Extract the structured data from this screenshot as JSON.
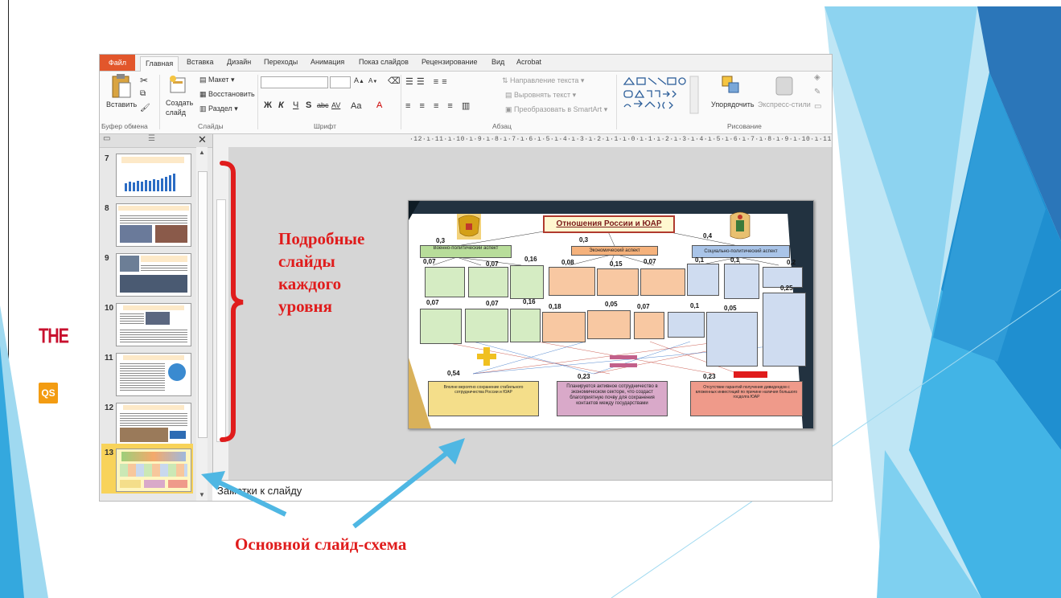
{
  "window": {
    "tabs": [
      "Файл",
      "Главная",
      "Вставка",
      "Дизайн",
      "Переходы",
      "Анимация",
      "Показ слайдов",
      "Рецензирование",
      "Вид",
      "Acrobat"
    ]
  },
  "ribbon": {
    "paste": "Вставить",
    "create_slide": "Создать",
    "create_slide_2": "слайд",
    "layout": "Макет",
    "restore": "Восстановить",
    "section": "Раздел",
    "text_direction": "Направление текста",
    "align_text": "Выровнять текст",
    "smartart": "Преобразовать в SmartArt",
    "arrange": "Упорядочить",
    "quick_styles": "Экспресс-стили",
    "group_clipboard": "Буфер обмена",
    "group_slides": "Слайды",
    "group_font": "Шрифт",
    "group_paragraph": "Абзац",
    "group_drawing": "Рисование",
    "font_bold": "Ж",
    "font_italic": "К",
    "font_underline": "Ч",
    "font_strike": "S",
    "font_abc": "abc",
    "font_av": "AV",
    "font_aa": "Aa",
    "font_grow": "A",
    "font_shrink": "A"
  },
  "thumbnails": {
    "numbers": [
      "7",
      "8",
      "9",
      "10",
      "11",
      "12",
      "13"
    ],
    "selected": "13"
  },
  "ruler": "·12·ı·11·ı·10·ı·9·ı·8·ı·7·ı·6·ı·5·ı·4·ı·3·ı·2·ı·1·ı·0·ı·1·ı·2·ı·3·ı·4·ı·5·ı·6·ı·7·ı·8·ı·9·ı·10·ı·11·ı·12·ı",
  "notes_placeholder": "Заметки к слайду",
  "main_slide": {
    "title": "Отношения России и ЮАР",
    "aspect_military": "Военно-политический аспект",
    "aspect_economic": "Экономический аспект",
    "aspect_social": "Социально-политический аспект",
    "weights_top": [
      "0,3",
      "0,3",
      "0,4"
    ],
    "weights_mid": [
      "0,07",
      "0,07",
      "0,16",
      "0,08",
      "0,15",
      "0,07",
      "0,1",
      "0,1",
      "0,2"
    ],
    "weights_low": [
      "0,07",
      "0,07",
      "0,16",
      "0,18",
      "0,05",
      "0,07",
      "0,1",
      "0,05",
      "0,25"
    ],
    "weights_bottom": [
      "0,54",
      "0,23",
      "0,23"
    ],
    "outcome_1": "Вполне вероятно сохранение стабильного сотрудничества России и ЮАР",
    "outcome_2": "Планируется активное сотрудничество в экономическом секторе, что создаст благоприятную почву для сохранения контактов между государствами",
    "outcome_3": "Отсутствие гарантий получения дивидендов с вложенных инвестиций по причине наличия большого госдолга ЮАР"
  },
  "annotations": {
    "detail_line1": "Подробные",
    "detail_line2": "слайды",
    "detail_line3": "каждого",
    "detail_line4": "уровня",
    "main_scheme": "Основной слайд-схема"
  },
  "logos": {
    "the": "THE",
    "qs": "QS"
  },
  "colors": {
    "accent_blue": "#29a8dd",
    "deco_light": "#bfe6f5",
    "annotation_red": "#e01c1c",
    "arrow_blue": "#4fb7e3",
    "file_tab": "#e2562b"
  }
}
